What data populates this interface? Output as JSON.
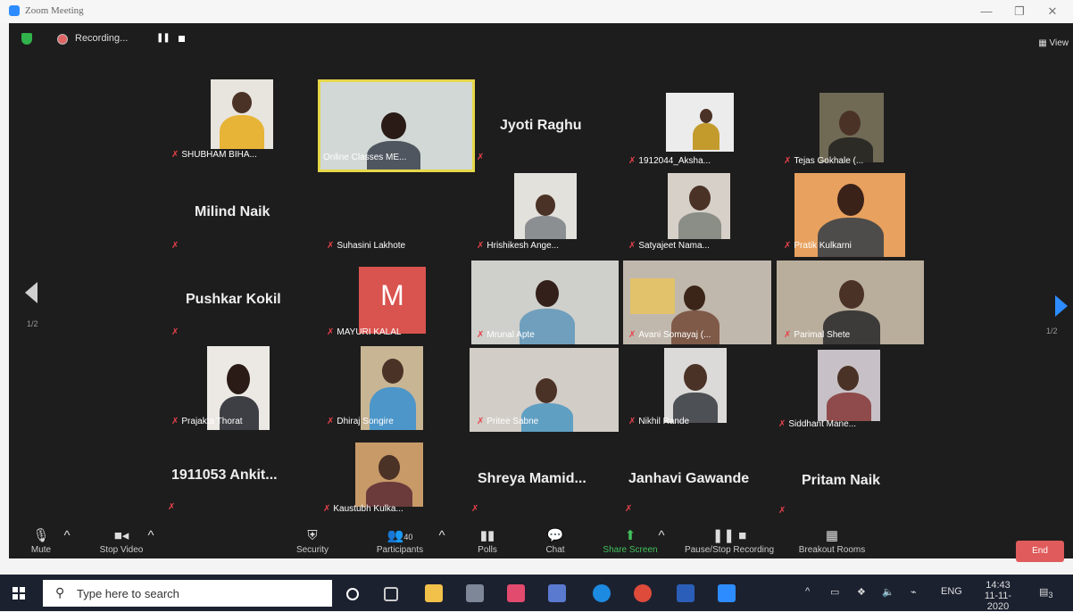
{
  "window": {
    "title": "Zoom Meeting",
    "minimize": "—",
    "restore": "❐",
    "close": "✕"
  },
  "topbar": {
    "recording": "Recording...",
    "pause": "❚❚",
    "view": "View"
  },
  "pager": {
    "left": "1/2",
    "right": "1/2"
  },
  "participants": [
    {
      "name": "SHUBHAM BIHA...",
      "type": "video"
    },
    {
      "name": "Online Classes ME...",
      "type": "video",
      "active": true
    },
    {
      "name": "Jyoti Raghu",
      "type": "name"
    },
    {
      "name": "1912044_Aksha...",
      "type": "video"
    },
    {
      "name": "Tejas Gokhale (...",
      "type": "video"
    },
    {
      "name": "Milind Naik",
      "type": "name"
    },
    {
      "name": "Suhasini Lakhote",
      "type": "label-only"
    },
    {
      "name": "Hrishikesh Ange...",
      "type": "video"
    },
    {
      "name": "Satyajeet Nama...",
      "type": "video"
    },
    {
      "name": "Pratik Kulkarni",
      "type": "video"
    },
    {
      "name": "Pushkar Kokil",
      "type": "name"
    },
    {
      "name": "MAYURI KALAL",
      "type": "avatar",
      "initial": "M"
    },
    {
      "name": "Mrunal Apte",
      "type": "video"
    },
    {
      "name": "Avani Somayaj (...",
      "type": "video"
    },
    {
      "name": "Parimal Shete",
      "type": "video"
    },
    {
      "name": "Prajakta Thorat",
      "type": "video"
    },
    {
      "name": "Dhiraj Songire",
      "type": "video"
    },
    {
      "name": "Pritee Sabne",
      "type": "video"
    },
    {
      "name": "Nikhil Rande",
      "type": "video"
    },
    {
      "name": "Siddhant Mane...",
      "type": "video"
    },
    {
      "name": "1911053  Ankit...",
      "type": "name"
    },
    {
      "name": "Kaustubh Kulka...",
      "type": "video"
    },
    {
      "name": "Shreya  Mamid...",
      "type": "name"
    },
    {
      "name": "Janhavi Gawande",
      "type": "name"
    },
    {
      "name": "Pritam Naik",
      "type": "name"
    }
  ],
  "toolbar": {
    "mute": "Mute",
    "stop_video": "Stop Video",
    "security": "Security",
    "participants": "Participants",
    "participants_count": "40",
    "polls": "Polls",
    "chat": "Chat",
    "share_screen": "Share Screen",
    "recording": "Pause/Stop Recording",
    "breakout": "Breakout Rooms",
    "end": "End"
  },
  "taskbar": {
    "search_placeholder": "Type here to search",
    "language": "ENG",
    "time": "14:43",
    "date": "11-11-2020",
    "notifications": "3"
  },
  "colors": {
    "accent": "#2d8cff",
    "end": "#e05b5b",
    "avatar": "#d9534f",
    "active_border": "#e6d84a"
  }
}
